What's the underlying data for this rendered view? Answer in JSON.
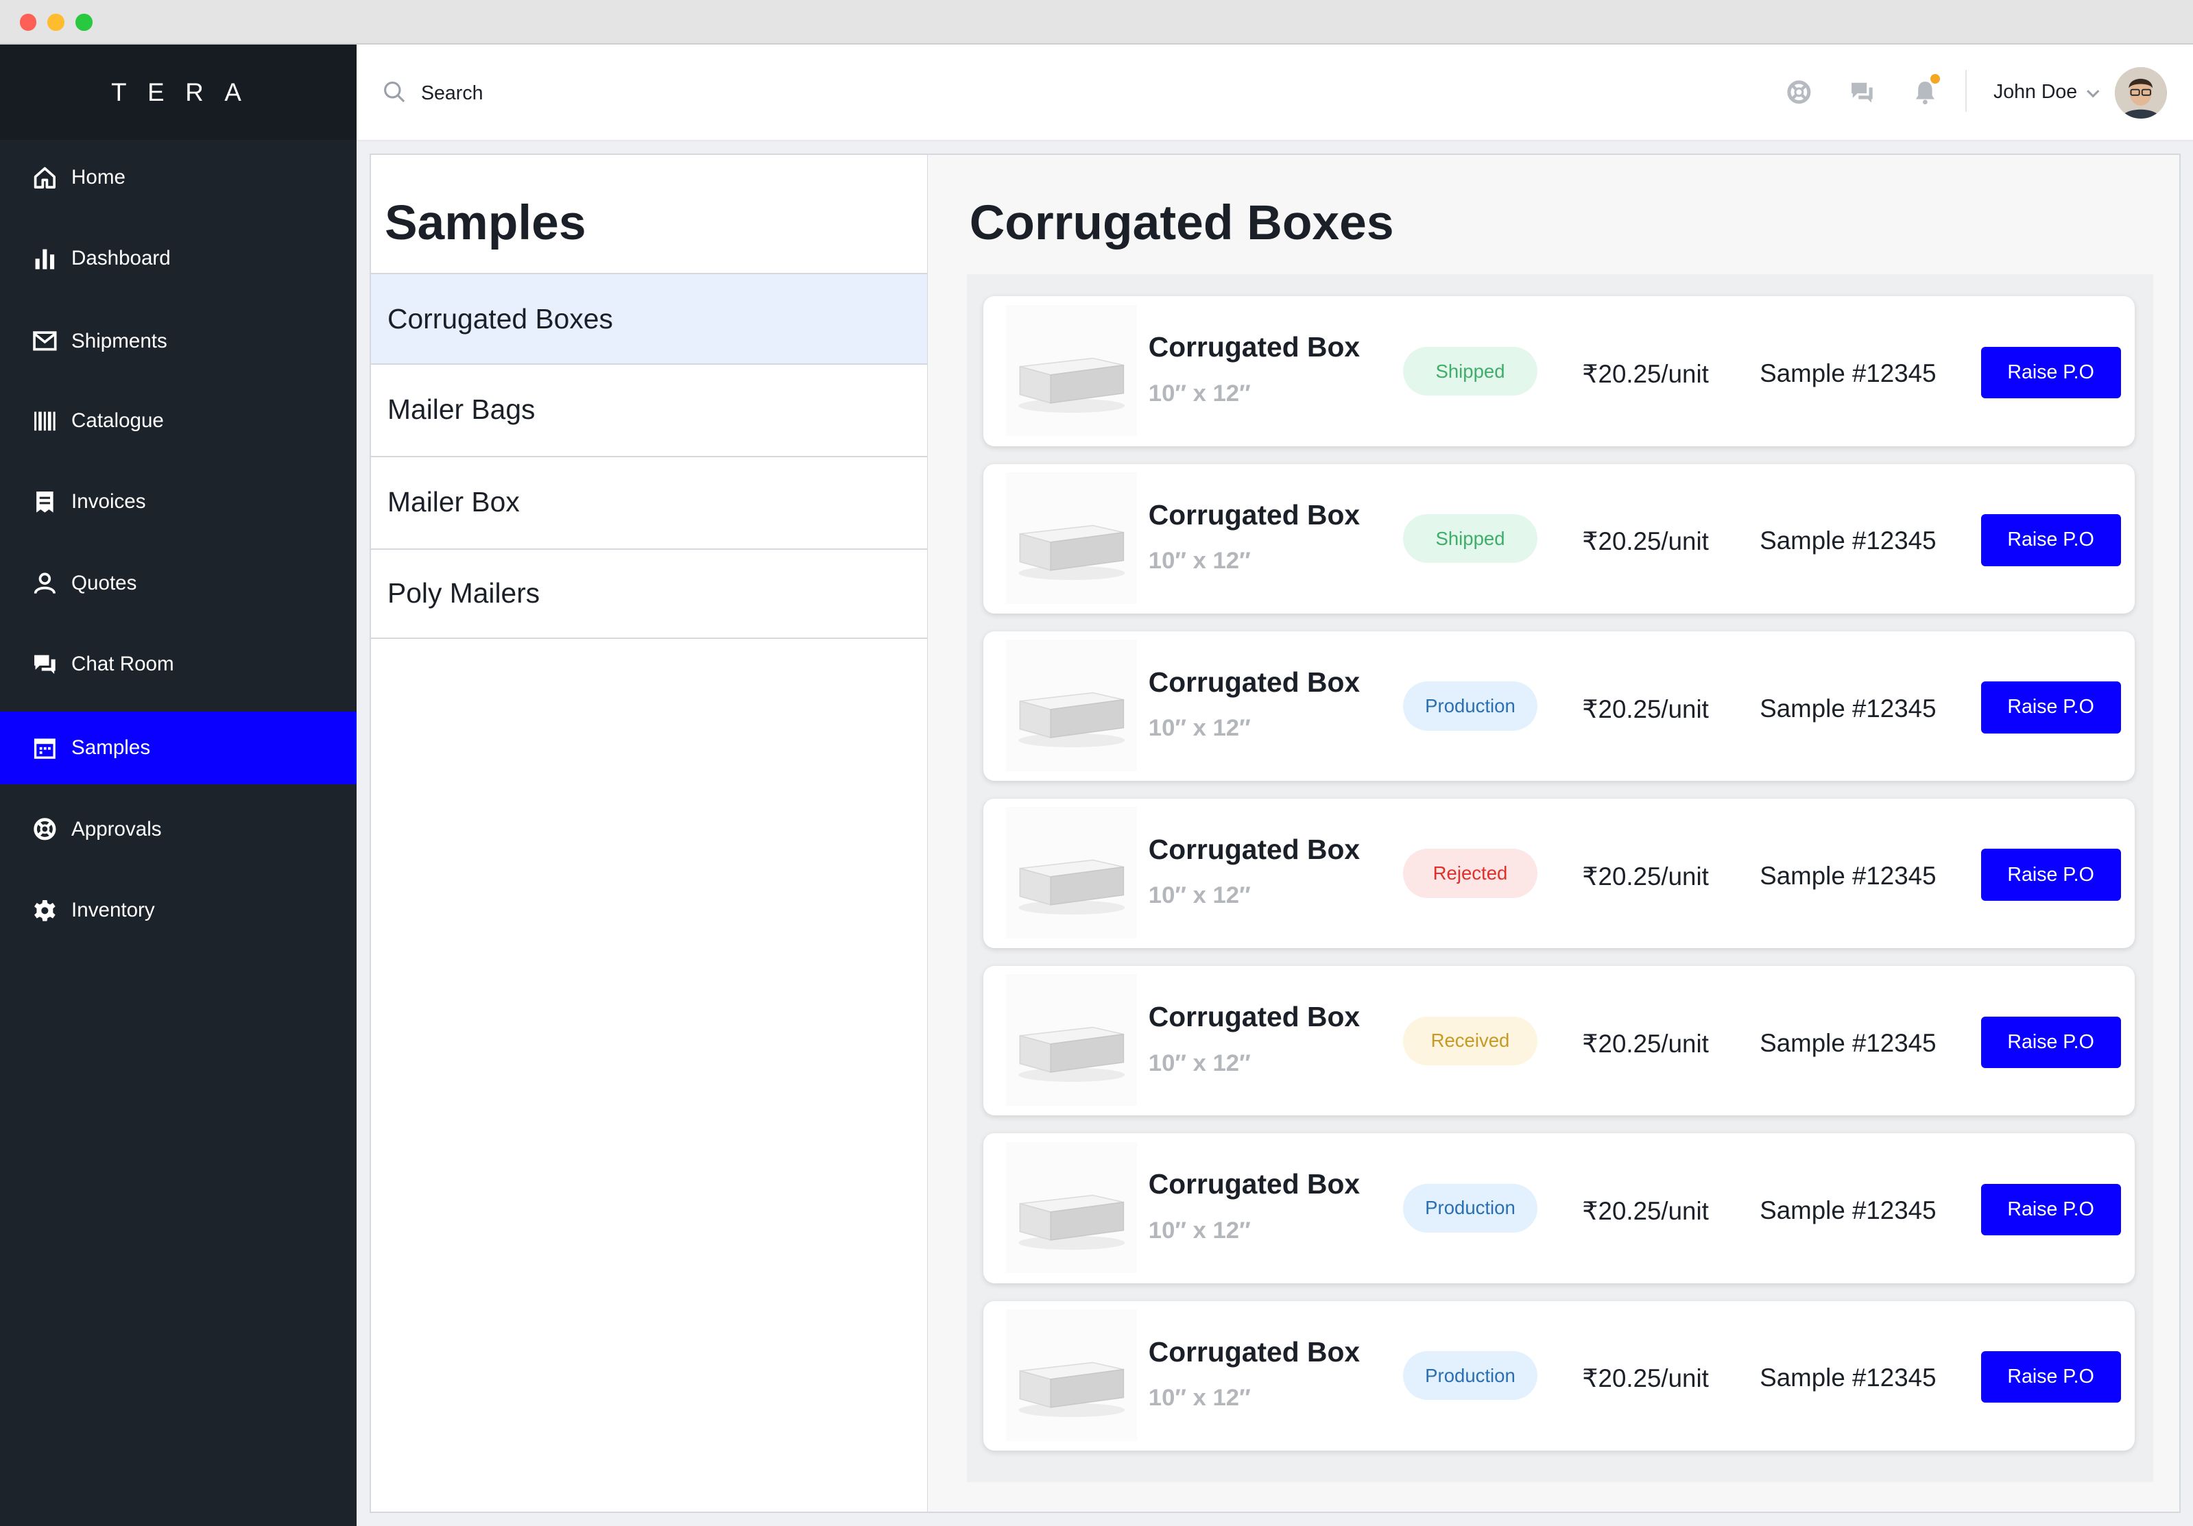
{
  "window": {
    "dots": [
      "#fe5f57",
      "#febc2e",
      "#28c840"
    ]
  },
  "brand": "TERA",
  "sidebar": {
    "items": [
      {
        "label": "Home",
        "icon": "home-icon"
      },
      {
        "label": "Dashboard",
        "icon": "bar-chart-icon"
      },
      {
        "label": "Shipments",
        "icon": "mail-icon"
      },
      {
        "label": "Catalogue",
        "icon": "barcode-icon"
      },
      {
        "label": "Invoices",
        "icon": "receipt-icon"
      },
      {
        "label": "Quotes",
        "icon": "user-icon"
      },
      {
        "label": "Chat Room",
        "icon": "chat-icon"
      },
      {
        "label": "Samples",
        "icon": "calendar-icon",
        "active": true
      },
      {
        "label": "Approvals",
        "icon": "lifebuoy-icon"
      },
      {
        "label": "Inventory",
        "icon": "gear-icon"
      }
    ]
  },
  "header": {
    "search_placeholder": "Search",
    "user_name": "John Doe",
    "notification_dot_color": "#f5a623"
  },
  "categories": {
    "title": "Samples",
    "items": [
      {
        "label": "Corrugated Boxes",
        "selected": true
      },
      {
        "label": "Mailer Bags"
      },
      {
        "label": "Mailer Box"
      },
      {
        "label": "Poly Mailers"
      }
    ]
  },
  "detail": {
    "title": "Corrugated Boxes",
    "rows": [
      {
        "name": "Corrugated Box",
        "size": "10″ x 12″",
        "status": "Shipped",
        "price": "₹20.25/unit",
        "sample": "Sample #12345",
        "action": "Raise P.O"
      },
      {
        "name": "Corrugated Box",
        "size": "10″ x 12″",
        "status": "Shipped",
        "price": "₹20.25/unit",
        "sample": "Sample #12345",
        "action": "Raise P.O"
      },
      {
        "name": "Corrugated Box",
        "size": "10″ x 12″",
        "status": "Production",
        "price": "₹20.25/unit",
        "sample": "Sample #12345",
        "action": "Raise P.O"
      },
      {
        "name": "Corrugated Box",
        "size": "10″ x 12″",
        "status": "Rejected",
        "price": "₹20.25/unit",
        "sample": "Sample #12345",
        "action": "Raise P.O"
      },
      {
        "name": "Corrugated Box",
        "size": "10″ x 12″",
        "status": "Received",
        "price": "₹20.25/unit",
        "sample": "Sample #12345",
        "action": "Raise P.O"
      },
      {
        "name": "Corrugated Box",
        "size": "10″ x 12″",
        "status": "Production",
        "price": "₹20.25/unit",
        "sample": "Sample #12345",
        "action": "Raise P.O"
      },
      {
        "name": "Corrugated Box",
        "size": "10″ x 12″",
        "status": "Production",
        "price": "₹20.25/unit",
        "sample": "Sample #12345",
        "action": "Raise P.O"
      }
    ]
  },
  "status_colors": {
    "Shipped": {
      "bg": "#e4f7ec",
      "fg": "#3fae6a"
    },
    "Production": {
      "bg": "#e2f1fd",
      "fg": "#2b6fb3"
    },
    "Rejected": {
      "bg": "#fde6e6",
      "fg": "#e0302b"
    },
    "Received": {
      "bg": "#fdf5df",
      "fg": "#c89a24"
    }
  },
  "accent_color": "#0a00ff"
}
